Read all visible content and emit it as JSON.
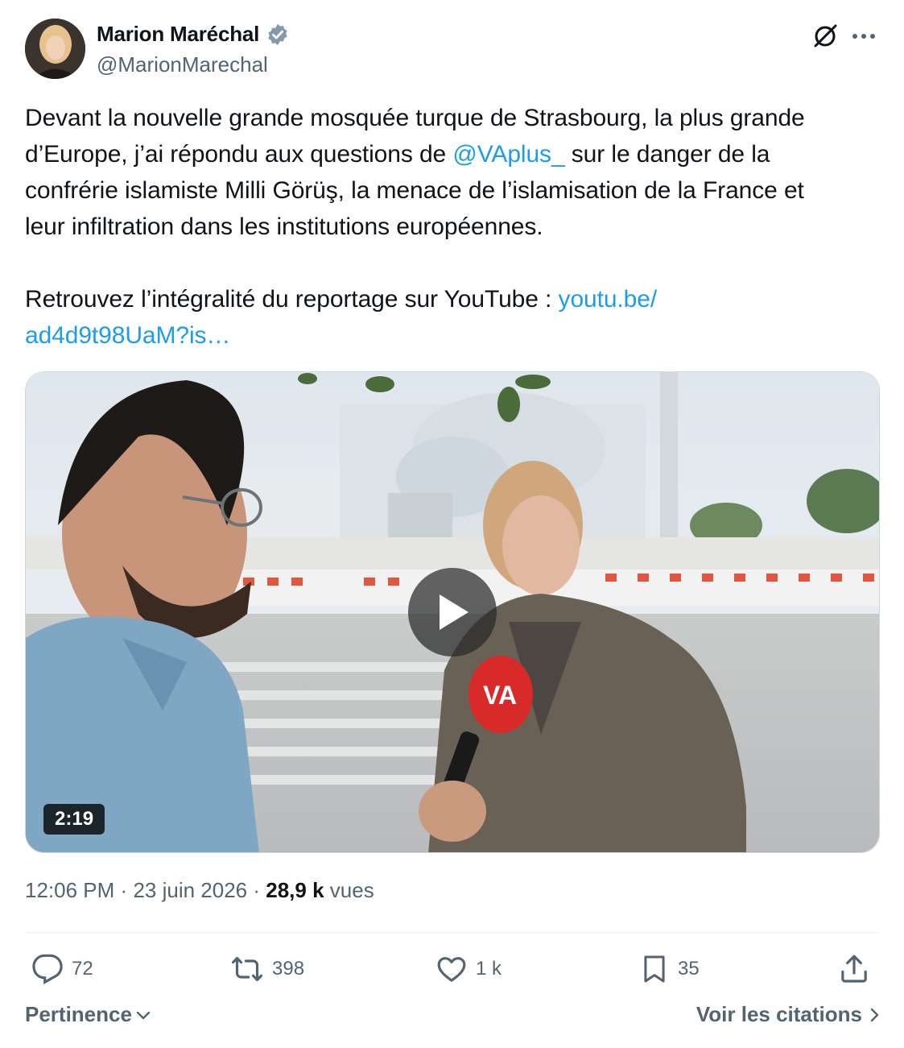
{
  "author": {
    "display_name": "Marion Maréchal",
    "handle": "@MarionMarechal",
    "verified": true,
    "verified_color": "#829aab"
  },
  "header_icons": [
    "grok-icon",
    "more-icon"
  ],
  "tweet": {
    "line1": "Devant la nouvelle grande mosquée turque de Strasbourg, la plus grande",
    "line2_before": "d’Europe, j’ai répondu aux questions de ",
    "mention": "@VAplus_",
    "line2_after": " sur le danger de la",
    "line3": "confrérie islamiste Milli Görüş, la menace de l’islamisation de la France et",
    "line4": "leur infiltration dans les institutions européennes.",
    "line5_before": "Retrouvez l’intégralité du reportage sur YouTube : ",
    "link_part1": "youtu.be/",
    "link_part2": "ad4d9t98UaM?is…"
  },
  "media": {
    "type": "video",
    "duration": "2:19",
    "mic_logo": "VA"
  },
  "meta": {
    "time": "12:06 PM",
    "separator": "·",
    "date": "23 juin 2026",
    "views_count": "28,9 k",
    "views_label": "vues"
  },
  "actions": {
    "replies": "72",
    "reposts": "398",
    "likes": "1 k",
    "bookmarks": "35"
  },
  "footer": {
    "sort_label": "Pertinence",
    "quotes_label": "Voir les citations"
  },
  "colors": {
    "text": "#0f1419",
    "secondary": "#536471",
    "link": "#1d9bf0",
    "divider": "#eff3f4"
  }
}
